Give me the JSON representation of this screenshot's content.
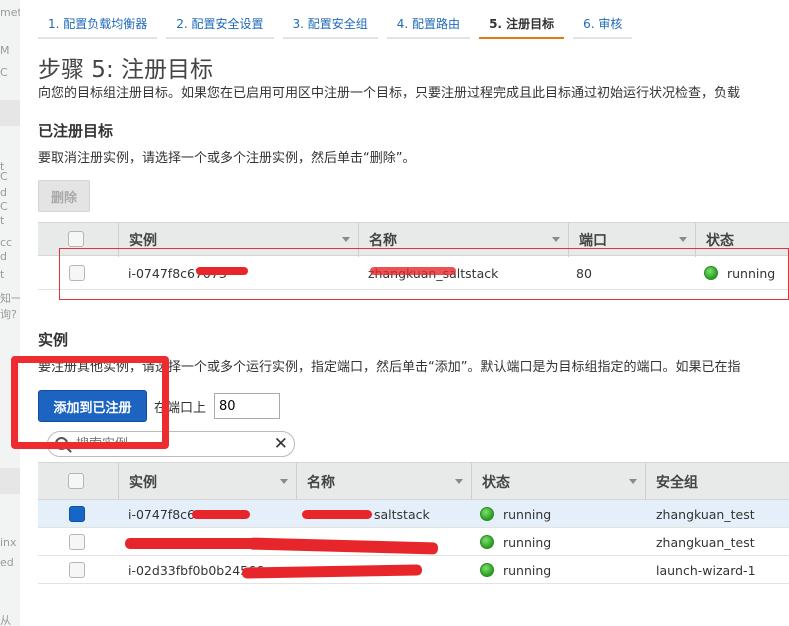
{
  "sidebar": {
    "fragments": [
      "met",
      "M",
      "C",
      "t",
      "C",
      "d",
      "C",
      "t",
      "cc",
      "d",
      "t",
      "知一",
      "询?",
      "inx",
      "ed",
      "从"
    ]
  },
  "tabs": [
    {
      "label": "1. 配置负载均衡器",
      "active": false
    },
    {
      "label": "2. 配置安全设置",
      "active": false
    },
    {
      "label": "3. 配置安全组",
      "active": false
    },
    {
      "label": "4. 配置路由",
      "active": false
    },
    {
      "label": "5. 注册目标",
      "active": true
    },
    {
      "label": "6. 审核",
      "active": false
    }
  ],
  "page": {
    "title": "步骤 5: 注册目标",
    "description": "向您的目标组注册目标。如果您在已启用可用区中注册一个目标，只要注册过程完成且此目标通过初始运行状况检查，负载"
  },
  "registered": {
    "title": "已注册目标",
    "description": "要取消注册实例，请选择一个或多个注册实例，然后单击“删除”。",
    "delete_label": "删除",
    "columns": [
      "实例",
      "名称",
      "端口",
      "状态"
    ],
    "rows": [
      {
        "instance": "i-0747f8c67073",
        "name": "zhangkuan_saltstack",
        "port": "80",
        "status": "running"
      }
    ]
  },
  "instances": {
    "title": "实例",
    "description": "要注册其他实例，请选择一个或多个运行实例，指定端口，然后单击“添加”。默认端口是为目标组指定的端口。如果已在指",
    "add_label": "添加到已注册",
    "port_label": "在端口上",
    "port_value": "80",
    "search_placeholder": "搜索实例",
    "columns": [
      "实例",
      "名称",
      "状态",
      "安全组"
    ],
    "rows": [
      {
        "instance": "i-0747f8c67",
        "name": "saltstack",
        "status": "running",
        "security_group": "zhangkuan_test",
        "selected": true
      },
      {
        "instance": "",
        "name": "",
        "status": "running",
        "security_group": "zhangkuan_test",
        "selected": false
      },
      {
        "instance": "i-02d33fbf0b0b24566",
        "name": "",
        "status": "running",
        "security_group": "launch-wizard-1",
        "selected": false
      }
    ]
  },
  "colors": {
    "accent_tab": "#e07b10",
    "link": "#1f6ab8",
    "primary_button": "#1c64c0",
    "annotation_red": "#ee2b2f",
    "status_green": "#2a9d1f"
  }
}
